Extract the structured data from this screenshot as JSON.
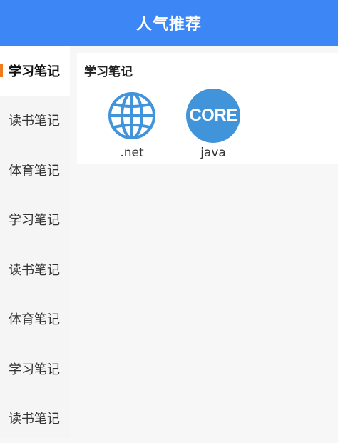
{
  "header": {
    "title": "人气推荐"
  },
  "sidebar": {
    "items": [
      {
        "label": "学习笔记",
        "active": true
      },
      {
        "label": "读书笔记",
        "active": false
      },
      {
        "label": "体育笔记",
        "active": false
      },
      {
        "label": "学习笔记",
        "active": false
      },
      {
        "label": "读书笔记",
        "active": false
      },
      {
        "label": "体育笔记",
        "active": false
      },
      {
        "label": "学习笔记",
        "active": false
      },
      {
        "label": "读书笔记",
        "active": false
      }
    ]
  },
  "content": {
    "section_title": "学习笔记",
    "items": [
      {
        "label": ".net",
        "icon": "globe-icon"
      },
      {
        "label": "java",
        "icon": "core-badge-icon",
        "badge_text": "CORE"
      }
    ]
  },
  "colors": {
    "header_bg": "#3d86f5",
    "active_indicator": "#f27a1a",
    "icon_blue": "#4194d9"
  }
}
